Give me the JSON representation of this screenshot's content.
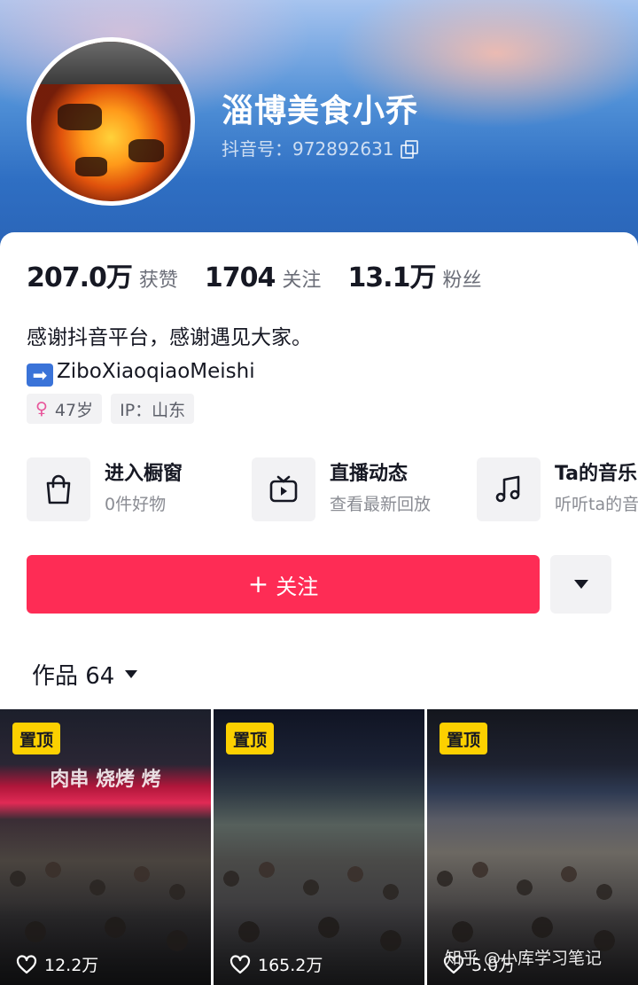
{
  "profile": {
    "username": "淄博美食小乔",
    "douyin_id": "抖音号：972892631"
  },
  "stats": [
    {
      "value": "207.0万",
      "label": "获赞"
    },
    {
      "value": "1704",
      "label": "关注"
    },
    {
      "value": "13.1万",
      "label": "粉丝"
    }
  ],
  "bio": {
    "line1": "感谢抖音平台，感谢遇见大家。",
    "line2": "ZiboXiaoqiaoMeishi"
  },
  "tags": {
    "age": "47岁",
    "ip": "IP：山东"
  },
  "features": [
    {
      "title": "进入橱窗",
      "subtitle": "0件好物",
      "icon": "shopping-bag-icon"
    },
    {
      "title": "直播动态",
      "subtitle": "查看最新回放",
      "icon": "tv-icon"
    },
    {
      "title": "Ta的音乐",
      "subtitle": "听听ta的音乐",
      "icon": "music-note-icon"
    }
  ],
  "actions": {
    "follow_label": "关注",
    "works_label": "作品 64"
  },
  "videos": [
    {
      "pinned": "置顶",
      "likes": "12.2万",
      "sign": "肉串 烧烤 烤"
    },
    {
      "pinned": "置顶",
      "likes": "165.2万",
      "sign": ""
    },
    {
      "pinned": "置顶",
      "likes": "5.0万",
      "sign": ""
    }
  ],
  "watermark": "知乎 @小库学习笔记",
  "colors": {
    "accent": "#fe2c55",
    "pin_badge": "#fcd000",
    "header_blue": "#2f6fc3"
  }
}
